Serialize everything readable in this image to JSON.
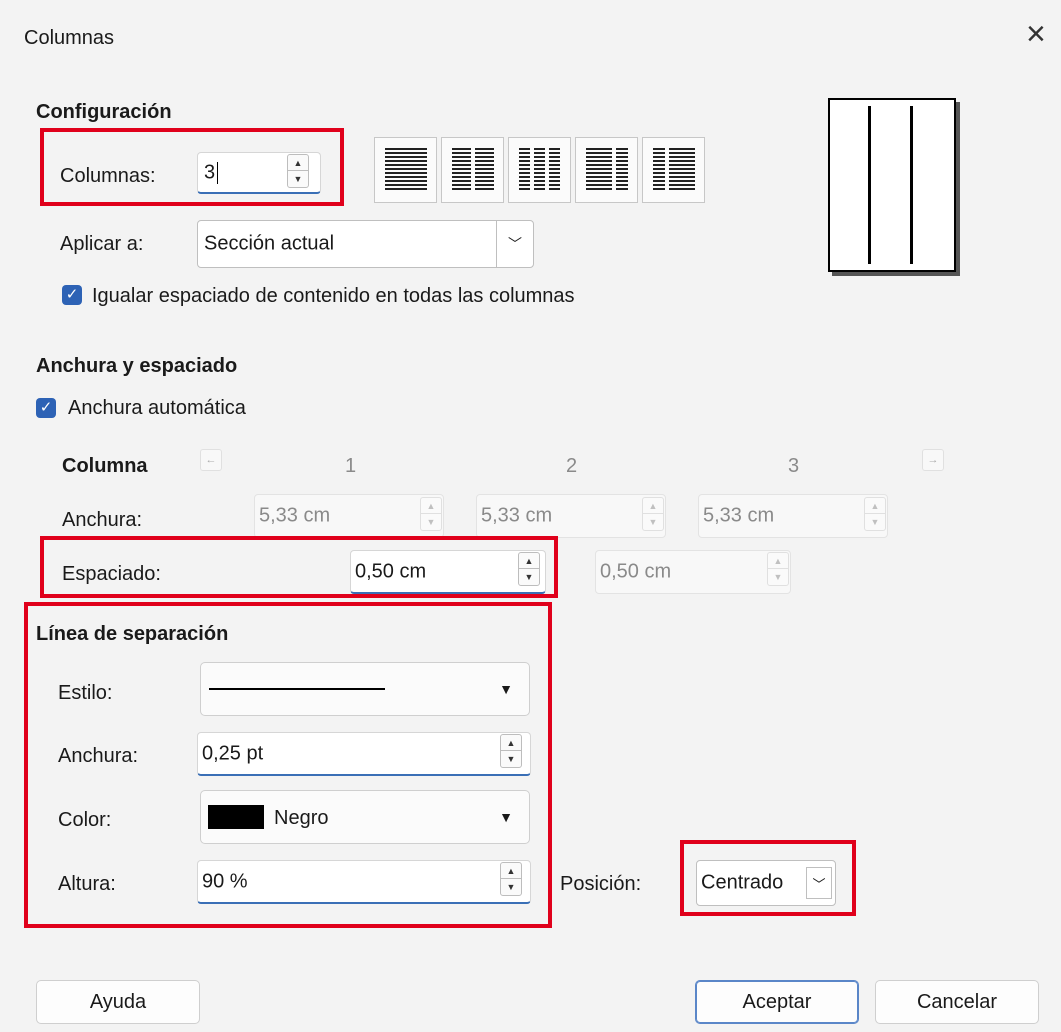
{
  "window": {
    "title": "Columnas",
    "close_icon": "×"
  },
  "config": {
    "heading": "Configuración",
    "columns_label": "Columnas:",
    "columns_value": "3",
    "presets": [
      "one-column-preset-icon",
      "two-columns-preset-icon",
      "three-columns-preset-icon",
      "left-large-preset-icon",
      "right-large-preset-icon"
    ],
    "apply_label": "Aplicar a:",
    "apply_value": "Sección actual",
    "even_label": "Igualar espaciado de contenido en todas las columnas",
    "even_checked": true
  },
  "width_spacing": {
    "heading": "Anchura y espaciado",
    "auto_label": "Anchura automática",
    "auto_checked": true,
    "column_label": "Columna",
    "col_numbers": [
      "1",
      "2",
      "3"
    ],
    "width_label": "Anchura:",
    "widths": [
      "5,33 cm",
      "5,33 cm",
      "5,33 cm"
    ],
    "spacing_label": "Espaciado:",
    "spacings": [
      "0,50 cm",
      "0,50 cm"
    ]
  },
  "separator": {
    "heading": "Línea de separación",
    "style_label": "Estilo:",
    "width_label": "Anchura:",
    "width_value": "0,25 pt",
    "color_label": "Color:",
    "color_value": "Negro",
    "color_hex": "#000000",
    "height_label": "Altura:",
    "height_value": "90 %",
    "position_label": "Posición:",
    "position_value": "Centrado"
  },
  "buttons": {
    "help": "Ayuda",
    "ok": "Aceptar",
    "cancel": "Cancelar"
  },
  "colors": {
    "highlight": "#e0001b",
    "checkbox": "#2d62b5"
  }
}
